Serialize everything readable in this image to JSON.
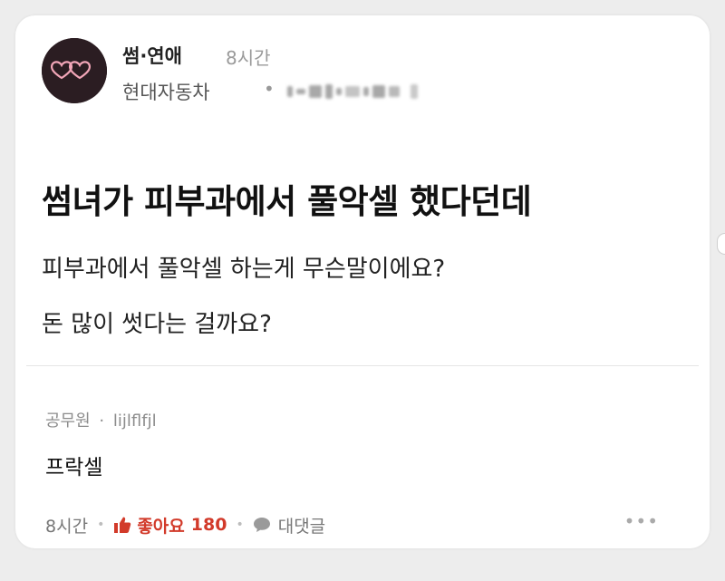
{
  "post": {
    "board": "썸·연애",
    "time_ago": "8시간",
    "company": "현대자동차",
    "separator": "•",
    "title": "썸녀가 피부과에서 풀악셀 했다던데",
    "body_lines": [
      "피부과에서 풀악셀 하는게 무슨말이에요?",
      "돈 많이 썻다는 걸까요?"
    ]
  },
  "comment": {
    "company": "공무원",
    "separator": "·",
    "username": "lijlflfjl",
    "text": "프락셀",
    "time_ago": "8시간",
    "like_label": "좋아요",
    "like_count": "180",
    "reply_label": "대댓글",
    "more_label": "•••"
  },
  "colors": {
    "like": "#d23a2a",
    "text": "#111111",
    "meta": "#8c8c8c",
    "avatar_bg": "#2b1d22",
    "hearts": "#f2a6b8"
  },
  "icons": {
    "avatar": "double-heart-icon",
    "like": "thumbs-up-icon",
    "reply": "speech-bubble-icon",
    "more": "more-dots-icon"
  }
}
